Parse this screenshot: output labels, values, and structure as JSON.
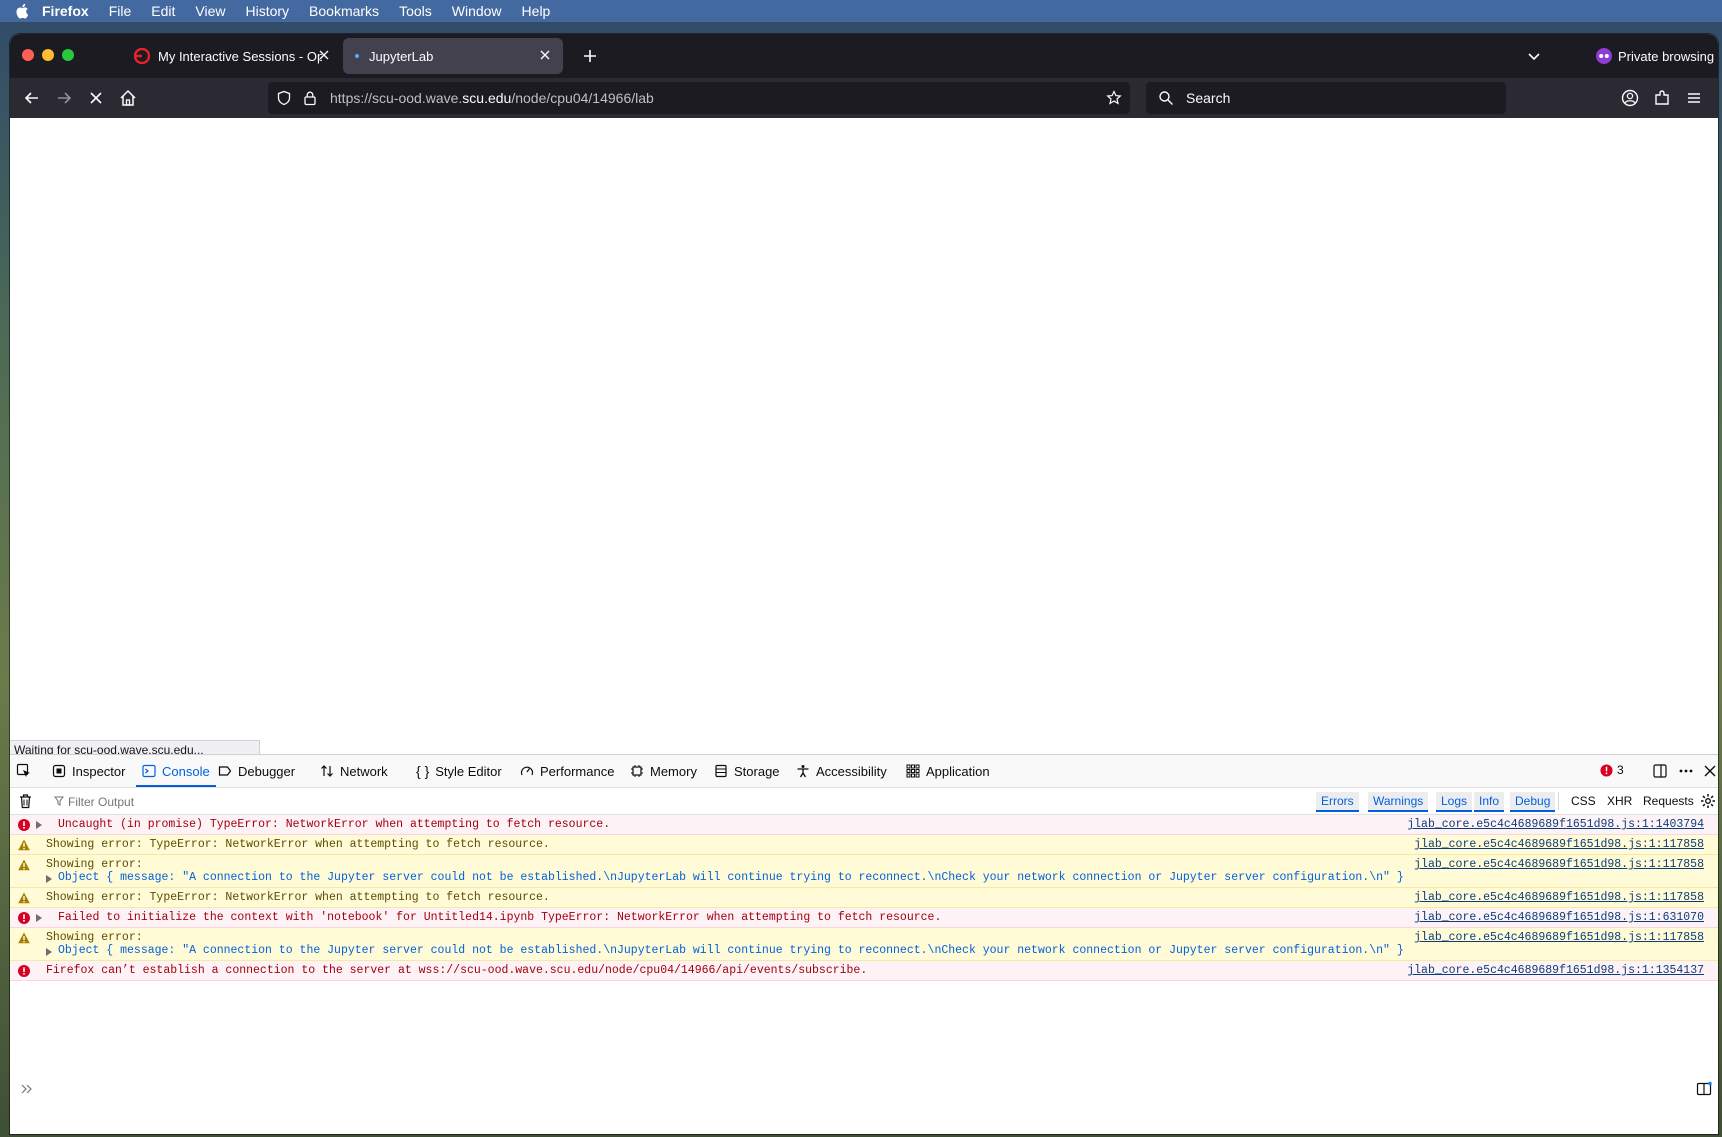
{
  "menubar": {
    "app_name": "Firefox",
    "items": [
      "File",
      "Edit",
      "View",
      "History",
      "Bookmarks",
      "Tools",
      "Window",
      "Help"
    ]
  },
  "tabs": [
    {
      "title": "My Interactive Sessions - Open",
      "active": false
    },
    {
      "title": "JupyterLab",
      "active": true
    }
  ],
  "private_browsing_label": "Private browsing",
  "navbar": {
    "url_prefix": "https://scu-ood.wave.",
    "url_host": "scu.edu",
    "url_path": "/node/cpu04/14966/lab",
    "search_placeholder": "Search"
  },
  "status": "Waiting for scu-ood.wave.scu.edu...",
  "devtools": {
    "tabs": [
      "Inspector",
      "Console",
      "Debugger",
      "Network",
      "Style Editor",
      "Performance",
      "Memory",
      "Storage",
      "Accessibility",
      "Application"
    ],
    "selected_tab": "Console",
    "error_count": "3",
    "filter_placeholder": "Filter Output",
    "filter_buttons": [
      "Errors",
      "Warnings",
      "Logs",
      "Info",
      "Debug",
      "CSS",
      "XHR",
      "Requests"
    ]
  },
  "console_messages": [
    {
      "level": "error",
      "expandable": true,
      "text": "Uncaught (in promise) TypeError: NetworkError when attempting to fetch resource.",
      "location": "jlab_core.e5c4c4689689f1651d98.js:1:1403794"
    },
    {
      "level": "warn",
      "expandable": false,
      "text": "Showing error: TypeError: NetworkError when attempting to fetch resource.",
      "location": "jlab_core.e5c4c4689689f1651d98.js:1:117858"
    },
    {
      "level": "warn",
      "expandable": false,
      "text": "Showing error:",
      "object_line": "Object { message: \"A connection to the Jupyter server could not be established.\\nJupyterLab will continue trying to reconnect.\\nCheck your network connection or Jupyter server configuration.\\n\" }",
      "location": "jlab_core.e5c4c4689689f1651d98.js:1:117858"
    },
    {
      "level": "warn",
      "expandable": false,
      "text": "Showing error: TypeError: NetworkError when attempting to fetch resource.",
      "location": "jlab_core.e5c4c4689689f1651d98.js:1:117858"
    },
    {
      "level": "error",
      "expandable": true,
      "text": "Failed to initialize the context with 'notebook' for Untitled14.ipynb TypeError: NetworkError when attempting to fetch resource.",
      "location": "jlab_core.e5c4c4689689f1651d98.js:1:631070"
    },
    {
      "level": "warn",
      "expandable": false,
      "text": "Showing error:",
      "object_line": "Object { message: \"A connection to the Jupyter server could not be established.\\nJupyterLab will continue trying to reconnect.\\nCheck your network connection or Jupyter server configuration.\\n\" }",
      "location": "jlab_core.e5c4c4689689f1651d98.js:1:117858"
    },
    {
      "level": "error",
      "expandable": false,
      "text": "Firefox can’t establish a connection to the server at wss://scu-ood.wave.scu.edu/node/cpu04/14966/api/events/subscribe.",
      "location": "jlab_core.e5c4c4689689f1651d98.js:1:1354137"
    }
  ]
}
